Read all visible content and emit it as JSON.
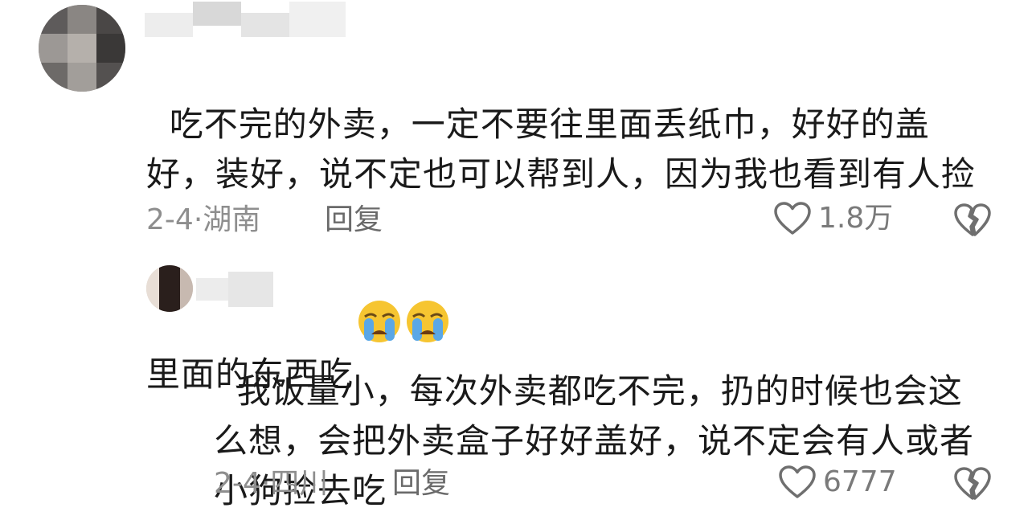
{
  "comments": [
    {
      "text": "吃不完的外卖，一定不要往里面丢纸巾，好好的盖好，装好，说不定也可以帮到人，因为我也看到有人捡里面的东西吃",
      "emoji": [
        "loudly-crying-face-icon",
        "loudly-crying-face-icon"
      ],
      "date": "2-4",
      "separator": "·",
      "location": "湖南",
      "reply_label": "回复",
      "likes": "1.8万"
    },
    {
      "text": "我饭量小，每次外卖都吃不完，扔的时候也会这么想，会把外卖盒子好好盖好，说不定会有人或者小狗捡去吃",
      "date": "2-4",
      "separator": "·",
      "location": "四川",
      "reply_label": "回复",
      "likes": "6777"
    }
  ],
  "colors": {
    "text": "#1a1a1a",
    "meta": "#8e8e8e",
    "icon": "#6f6f6f",
    "emoji": "#f6c531",
    "tears": "#5aa7e6"
  }
}
